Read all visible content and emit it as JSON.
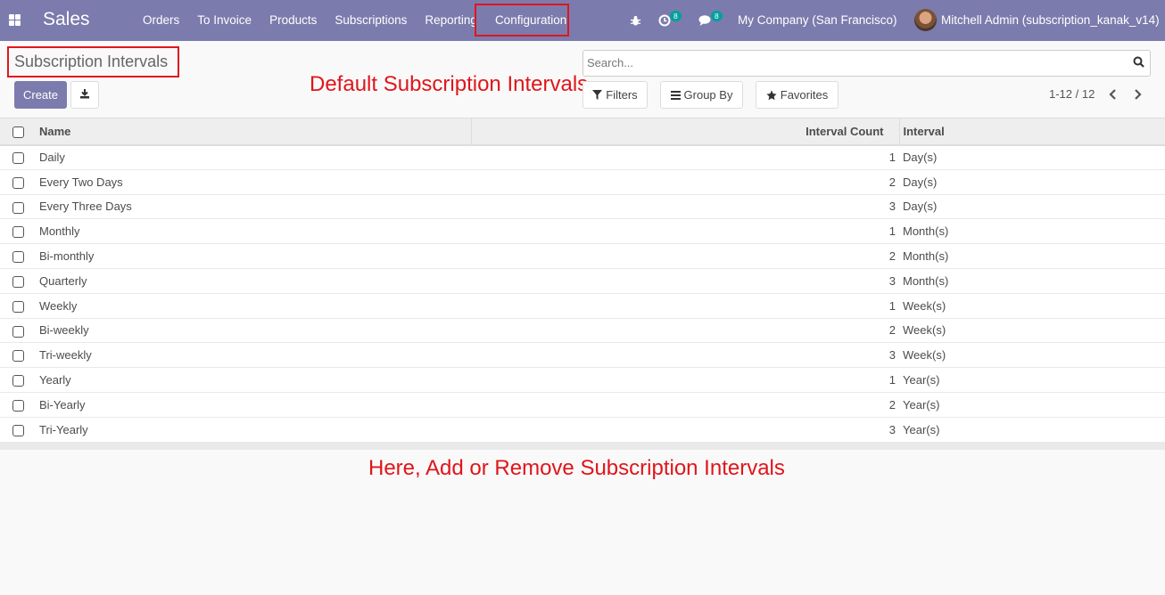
{
  "navbar": {
    "app_name": "Sales",
    "menu": [
      "Orders",
      "To Invoice",
      "Products",
      "Subscriptions",
      "Reporting",
      "Configuration"
    ],
    "activity_count": "8",
    "message_count": "8",
    "company": "My Company (San Francisco)",
    "user": "Mitchell Admin (subscription_kanak_v14)"
  },
  "control_panel": {
    "title": "Subscription Intervals",
    "create_label": "Create",
    "search_placeholder": "Search...",
    "filters_label": "Filters",
    "group_by_label": "Group By",
    "favorites_label": "Favorites",
    "pager": "1-12 / 12"
  },
  "annotations": {
    "default_note": "Default Subscription Intervals",
    "bottom_note": "Here, Add or Remove Subscription Intervals",
    "color": "#e0151b"
  },
  "table": {
    "headers": {
      "name": "Name",
      "count": "Interval Count",
      "interval": "Interval"
    },
    "rows": [
      {
        "name": "Daily",
        "count": "1",
        "interval": "Day(s)"
      },
      {
        "name": "Every Two Days",
        "count": "2",
        "interval": "Day(s)"
      },
      {
        "name": "Every Three Days",
        "count": "3",
        "interval": "Day(s)"
      },
      {
        "name": "Monthly",
        "count": "1",
        "interval": "Month(s)"
      },
      {
        "name": "Bi-monthly",
        "count": "2",
        "interval": "Month(s)"
      },
      {
        "name": "Quarterly",
        "count": "3",
        "interval": "Month(s)"
      },
      {
        "name": "Weekly",
        "count": "1",
        "interval": "Week(s)"
      },
      {
        "name": "Bi-weekly",
        "count": "2",
        "interval": "Week(s)"
      },
      {
        "name": "Tri-weekly",
        "count": "3",
        "interval": "Week(s)"
      },
      {
        "name": "Yearly",
        "count": "1",
        "interval": "Year(s)"
      },
      {
        "name": "Bi-Yearly",
        "count": "2",
        "interval": "Year(s)"
      },
      {
        "name": "Tri-Yearly",
        "count": "3",
        "interval": "Year(s)"
      }
    ]
  },
  "colors": {
    "brand": "#7c7bad",
    "badge": "#00a09d",
    "highlight": "#e0151b"
  },
  "icons": [
    "apps-icon",
    "bug-icon",
    "activity-icon",
    "chat-icon",
    "download-icon",
    "search-icon",
    "filter-icon",
    "group-by-icon",
    "star-icon",
    "chevron-left-icon",
    "chevron-right-icon"
  ]
}
